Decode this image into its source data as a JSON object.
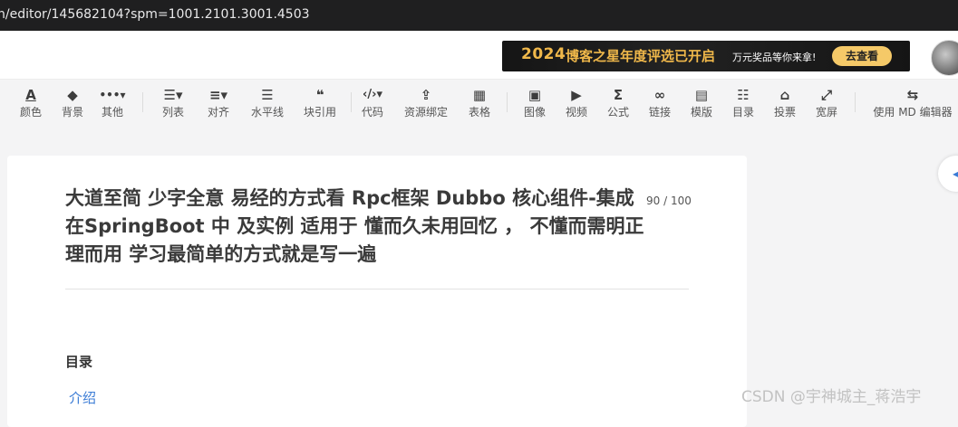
{
  "browser": {
    "url": "n/editor/145682104?spm=1001.2101.3001.4503"
  },
  "banner": {
    "year": "2024",
    "title": "博客之星年度评选已开启",
    "subtitle": "万元奖品等你来拿!",
    "cta": "去查看"
  },
  "toolbar": {
    "items": [
      {
        "label": "颜色",
        "icon": "A"
      },
      {
        "label": "背景",
        "icon": "◆"
      },
      {
        "label": "其他",
        "icon": "•••▾"
      },
      {
        "label": "列表",
        "icon": "☰▾"
      },
      {
        "label": "对齐",
        "icon": "≡▾"
      },
      {
        "label": "水平线",
        "icon": "☰"
      },
      {
        "label": "块引用",
        "icon": "❝"
      },
      {
        "label": "代码",
        "icon": "‹/›▾"
      },
      {
        "label": "资源绑定",
        "icon": "⇪"
      },
      {
        "label": "表格",
        "icon": "▦"
      },
      {
        "label": "图像",
        "icon": "▣"
      },
      {
        "label": "视频",
        "icon": "▶"
      },
      {
        "label": "公式",
        "icon": "Σ"
      },
      {
        "label": "链接",
        "icon": "∞"
      },
      {
        "label": "模版",
        "icon": "▤"
      },
      {
        "label": "目录",
        "icon": "☷"
      },
      {
        "label": "投票",
        "icon": "⌂"
      },
      {
        "label": "宽屏",
        "icon": "⤢"
      },
      {
        "label": "使用 MD 编辑器",
        "icon": "⇆"
      }
    ]
  },
  "editor": {
    "title": "大道至简 少字全意 易经的方式看 Rpc框架 Dubbo 核心组件-集成在SpringBoot 中 及实例 适用于 懂而久未用回忆 ， 不懂而需明正理而用 学习最简单的方式就是写一遍",
    "title_counter": "90 / 100",
    "toc_heading": "目录",
    "toc_item": "介绍"
  },
  "watermark": "CSDN @宇神城主_蒋浩宇"
}
